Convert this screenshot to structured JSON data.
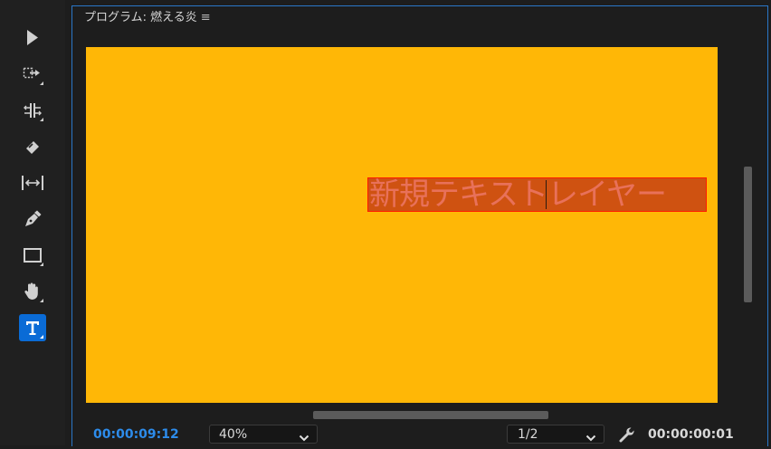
{
  "panel": {
    "title": "プログラム: 燃える炎",
    "menu_icon": "hamburger-menu-icon"
  },
  "tools": [
    {
      "name": "selection-tool",
      "icon": "arrow-pointer-icon"
    },
    {
      "name": "track-select-forward-tool",
      "icon": "track-select-icon"
    },
    {
      "name": "ripple-edit-tool",
      "icon": "ripple-edit-icon"
    },
    {
      "name": "razor-tool",
      "icon": "razor-icon"
    },
    {
      "name": "slip-tool",
      "icon": "slip-icon"
    },
    {
      "name": "pen-tool",
      "icon": "pen-icon"
    },
    {
      "name": "rectangle-tool",
      "icon": "rectangle-icon"
    },
    {
      "name": "hand-tool",
      "icon": "hand-icon"
    },
    {
      "name": "type-tool",
      "icon": "type-icon",
      "active": true
    }
  ],
  "canvas": {
    "background": "#ffb706",
    "text_layer": {
      "text": "新規テキストレイヤー",
      "outline_color": "#ff1b00"
    }
  },
  "footer": {
    "playhead_timecode": "00:00:09:12",
    "zoom_value": "40%",
    "resolution_value": "1/2",
    "settings_icon": "wrench-icon",
    "duration_timecode": "00:00:00:01"
  },
  "colors": {
    "accent": "#2d8ceb",
    "active_tool": "#0a6bd6",
    "panel_border": "#2a77c8"
  }
}
